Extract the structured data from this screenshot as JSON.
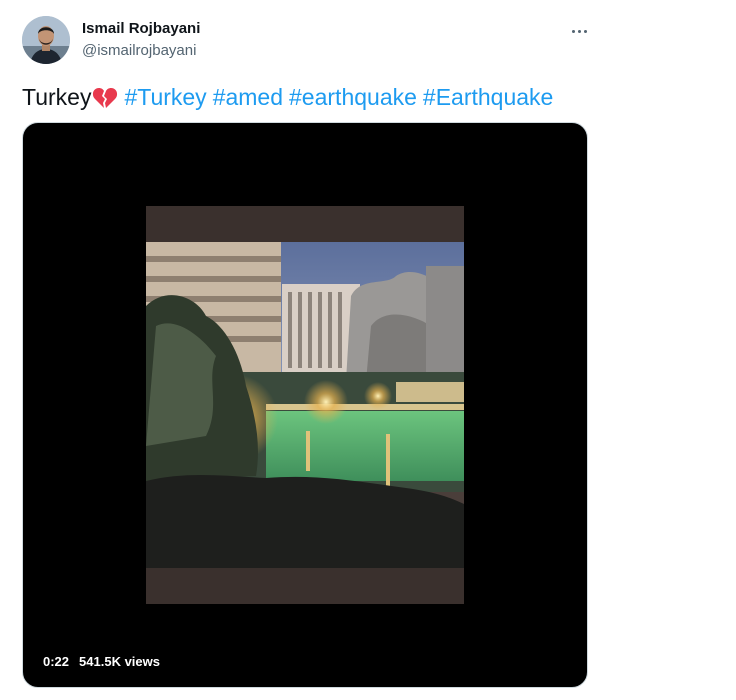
{
  "author": {
    "name": "Ismail Rojbayani",
    "handle": "@ismailrojbayani"
  },
  "more_icon": "ellipsis-icon",
  "tweet": {
    "text": "Turkey",
    "emoji_icon": "broken-heart-icon",
    "hashtags": [
      "#Turkey",
      "#amed",
      "#earthquake",
      "#Earthquake"
    ]
  },
  "video": {
    "duration": "0:22",
    "views": "541.5K views"
  },
  "colors": {
    "link": "#1d9bf0",
    "text": "#0f1419",
    "secondary": "#536471"
  }
}
